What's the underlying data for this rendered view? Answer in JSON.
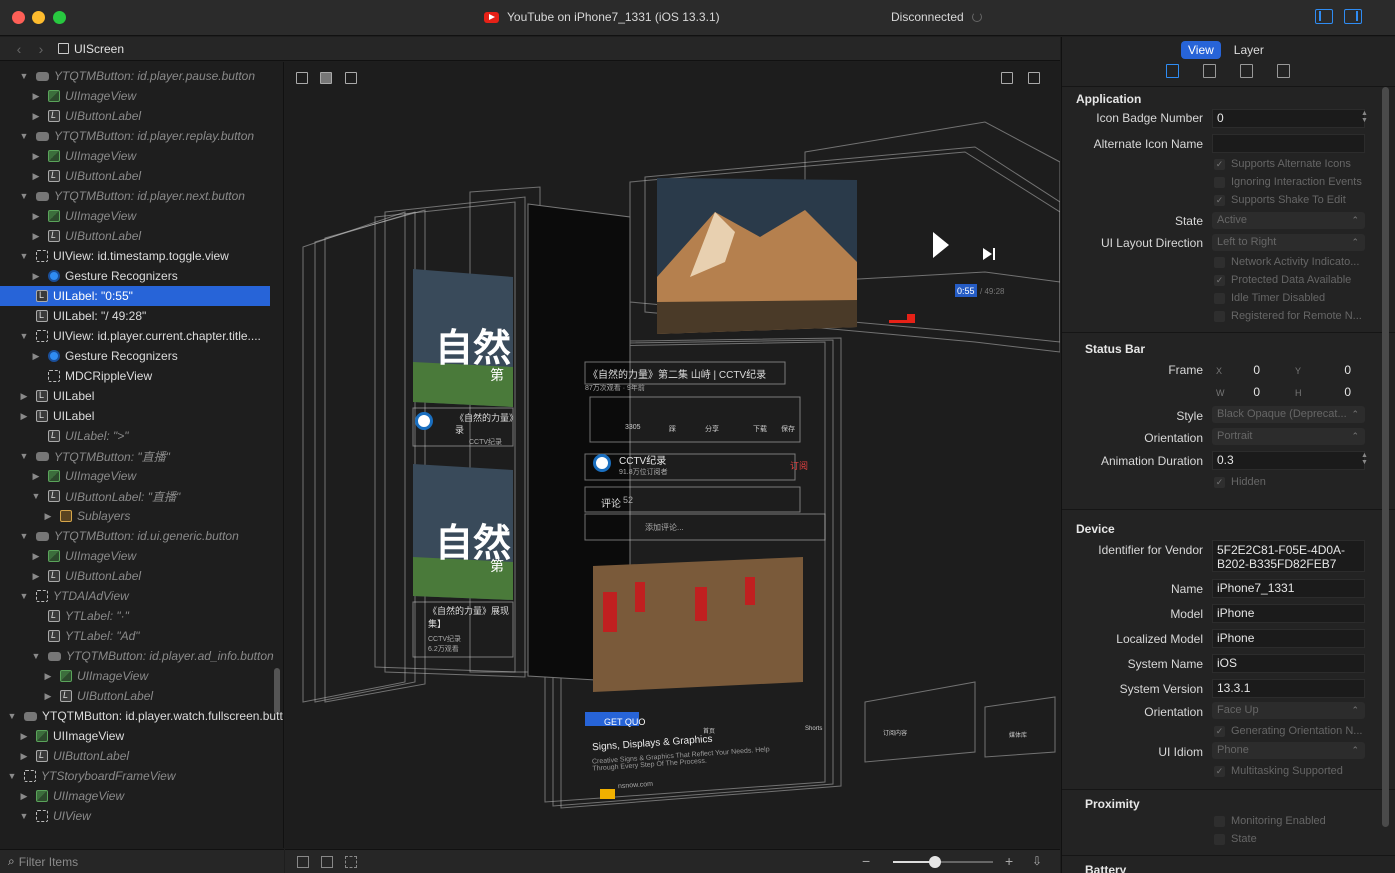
{
  "window": {
    "title": "YouTube on iPhone7_1331 (iOS 13.3.1)",
    "status": "Disconnected"
  },
  "path": {
    "crumb": "UIScreen"
  },
  "tree": {
    "rows": [
      {
        "label": "YTQTMButton: id.player.pause.button",
        "kind": "btn",
        "dim": true,
        "disc": "▼"
      },
      {
        "label": "UIImageView",
        "kind": "img",
        "dim": true,
        "disc": "▶"
      },
      {
        "label": "UIButtonLabel",
        "kind": "lbl",
        "dim": true,
        "disc": "▶"
      },
      {
        "label": "YTQTMButton: id.player.replay.button",
        "kind": "btn",
        "dim": true,
        "disc": "▼"
      },
      {
        "label": "UIImageView",
        "kind": "img",
        "dim": true,
        "disc": "▶"
      },
      {
        "label": "UIButtonLabel",
        "kind": "lbl",
        "dim": true,
        "disc": "▶"
      },
      {
        "label": "YTQTMButton: id.player.next.button",
        "kind": "btn",
        "dim": true,
        "disc": "▼"
      },
      {
        "label": "UIImageView",
        "kind": "img",
        "dim": true,
        "disc": "▶"
      },
      {
        "label": "UIButtonLabel",
        "kind": "lbl",
        "dim": true,
        "disc": "▶"
      },
      {
        "label": "UIView: id.timestamp.toggle.view",
        "kind": "view",
        "dim": false,
        "disc": "▼"
      },
      {
        "label": "Gesture Recognizers",
        "kind": "ges",
        "dim": false,
        "disc": "▶"
      },
      {
        "label": "UILabel: \"0:55\"",
        "kind": "lbl",
        "dim": false,
        "disc": "",
        "selected": true
      },
      {
        "label": "UILabel: \"/ 49:28\"",
        "kind": "lbl",
        "dim": false,
        "disc": ""
      },
      {
        "label": "UIView: id.player.current.chapter.title....",
        "kind": "view",
        "dim": false,
        "disc": "▼"
      },
      {
        "label": "Gesture Recognizers",
        "kind": "ges",
        "dim": false,
        "disc": "▶"
      },
      {
        "label": "MDCRippleView",
        "kind": "view",
        "dim": false,
        "disc": ""
      },
      {
        "label": "UILabel",
        "kind": "lbl",
        "dim": false,
        "disc": "▶"
      },
      {
        "label": "UILabel",
        "kind": "lbl",
        "dim": false,
        "disc": "▶"
      },
      {
        "label": "UILabel: \">\"",
        "kind": "lbl",
        "dim": true,
        "disc": ""
      },
      {
        "label": "YTQTMButton: \"直播\"",
        "kind": "btn",
        "dim": true,
        "disc": "▼"
      },
      {
        "label": "UIImageView",
        "kind": "img",
        "dim": true,
        "disc": "▶"
      },
      {
        "label": "UIButtonLabel: \"直播\"",
        "kind": "lbl",
        "dim": true,
        "disc": "▼"
      },
      {
        "label": "Sublayers",
        "kind": "sub",
        "dim": true,
        "disc": "▶"
      },
      {
        "label": "YTQTMButton: id.ui.generic.button",
        "kind": "btn",
        "dim": true,
        "disc": "▼"
      },
      {
        "label": "UIImageView",
        "kind": "img",
        "dim": true,
        "disc": "▶"
      },
      {
        "label": "UIButtonLabel",
        "kind": "lbl",
        "dim": true,
        "disc": "▶"
      },
      {
        "label": "YTDAIAdView",
        "kind": "view",
        "dim": true,
        "disc": "▼"
      },
      {
        "label": "YTLabel: \"·\"",
        "kind": "lbl",
        "dim": true,
        "disc": ""
      },
      {
        "label": "YTLabel: \"Ad\"",
        "kind": "lbl",
        "dim": true,
        "disc": ""
      },
      {
        "label": "YTQTMButton: id.player.ad_info.button",
        "kind": "btn",
        "dim": true,
        "disc": "▼"
      },
      {
        "label": "UIImageView",
        "kind": "img",
        "dim": true,
        "disc": "▶"
      },
      {
        "label": "UIButtonLabel",
        "kind": "lbl",
        "dim": true,
        "disc": "▶"
      },
      {
        "label": "YTQTMButton: id.player.watch.fullscreen.button",
        "kind": "btn",
        "dim": false,
        "disc": "▼"
      },
      {
        "label": "UIImageView",
        "kind": "img",
        "dim": false,
        "disc": "▶"
      },
      {
        "label": "UIButtonLabel",
        "kind": "lbl",
        "dim": true,
        "disc": "▶"
      },
      {
        "label": "YTStoryboardFrameView",
        "kind": "view",
        "dim": true,
        "disc": "▼"
      },
      {
        "label": "UIImageView",
        "kind": "img",
        "dim": true,
        "disc": "▶"
      },
      {
        "label": "UIView",
        "kind": "view",
        "dim": true,
        "disc": "▼"
      }
    ]
  },
  "filter": {
    "placeholder": "Filter Items"
  },
  "canvas": {
    "video_title": "《自然的力量》第二集 山峙 | CCTV纪录",
    "video_meta": "87万次观看 · 9年前",
    "actions": [
      "3305",
      "踩",
      "分享",
      "下载",
      "保存"
    ],
    "channel_name": "CCTV纪录",
    "channel_subs": "91.8万位订阅者",
    "subscribe": "订阅",
    "comments_label": "评论",
    "comments_count": "52",
    "add_comment": "添加评论...",
    "timestamp": "0:55",
    "duration": "/ 49:28",
    "thumb_text_1": "自然",
    "thumb_sub_1": "第",
    "card_title_1": "《自然的力量》",
    "card_title_1b": "录",
    "card_channel_1": "CCTV纪录",
    "card_title_2": "《自然的力量》展现",
    "card_title_2b": "集】",
    "card_channel_2": "CCTV纪录",
    "card_meta_2": "6.2万观看",
    "ad_cta": "GET QUO",
    "ad_title": "Signs, Displays & Graphics",
    "ad_desc": "Creative Signs & Graphics That Reflect Your Needs. Help Through Every Step Of The Process.",
    "ad_domain": "nsnow.com",
    "tabbar": [
      "首页",
      "Shorts",
      "订阅内容",
      "媒体库"
    ]
  },
  "inspector": {
    "tabs": [
      "View",
      "Layer"
    ],
    "application": {
      "title": "Application",
      "icon_badge_label": "Icon Badge Number",
      "icon_badge_value": "0",
      "alt_icon_label": "Alternate Icon Name",
      "alt_icon_value": "",
      "checks": [
        "Supports Alternate Icons",
        "Ignoring Interaction Events",
        "Supports Shake To Edit"
      ],
      "state_label": "State",
      "state_value": "Active",
      "layout_label": "UI Layout Direction",
      "layout_value": "Left to Right",
      "checks2": [
        "Network Activity Indicato...",
        "Protected Data Available",
        "Idle Timer Disabled",
        "Registered for Remote N..."
      ]
    },
    "status_bar": {
      "title": "Status Bar",
      "frame_label": "Frame",
      "x_label": "X",
      "x": "0",
      "y_label": "Y",
      "y": "0",
      "w_label": "W",
      "w": "0",
      "h_label": "H",
      "h": "0",
      "style_label": "Style",
      "style_value": "Black Opaque (Deprecat...",
      "orientation_label": "Orientation",
      "orientation_value": "Portrait",
      "anim_label": "Animation Duration",
      "anim_value": "0.3",
      "hidden_label": "Hidden"
    },
    "device": {
      "title": "Device",
      "vendor_label": "Identifier for Vendor",
      "vendor_value": "5F2E2C81-F05E-4D0A-B202-B335FD82FEB7",
      "name_label": "Name",
      "name_value": "iPhone7_1331",
      "model_label": "Model",
      "model_value": "iPhone",
      "lmodel_label": "Localized Model",
      "lmodel_value": "iPhone",
      "sysname_label": "System Name",
      "sysname_value": "iOS",
      "sysver_label": "System Version",
      "sysver_value": "13.3.1",
      "orient_label": "Orientation",
      "orient_value": "Face Up",
      "gen_orient": "Generating Orientation N...",
      "idiom_label": "UI Idiom",
      "idiom_value": "Phone",
      "multitask": "Multitasking Supported"
    },
    "proximity": {
      "title": "Proximity",
      "monitoring": "Monitoring Enabled",
      "state": "State"
    },
    "battery": {
      "title": "Battery"
    }
  }
}
